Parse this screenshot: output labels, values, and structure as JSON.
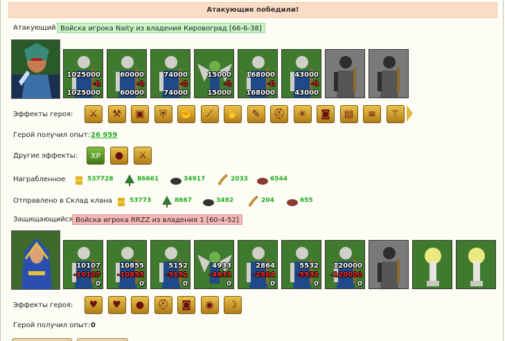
{
  "banner": {
    "text": "Атакующие победили!"
  },
  "attacker": {
    "label": "Атакующий",
    "army_name": "Войска игрока Naity из владения Кировоград [66-6-38]",
    "units": [
      {
        "name": "unit-1",
        "icon": "knight-icon",
        "count": "1025000",
        "loss": "-0",
        "remaining": "1025000"
      },
      {
        "name": "unit-2",
        "icon": "armored-warrior-icon",
        "count": "60000",
        "loss": "-0",
        "remaining": "60000"
      },
      {
        "name": "unit-3",
        "icon": "paladin-icon",
        "count": "74000",
        "loss": "-0",
        "remaining": "74000"
      },
      {
        "name": "unit-4",
        "icon": "winged-goblin-icon",
        "count": "15000",
        "loss": "-0",
        "remaining": "15000"
      },
      {
        "name": "unit-5",
        "icon": "archer-icon",
        "count": "168000",
        "loss": "-0",
        "remaining": "168000"
      },
      {
        "name": "unit-6",
        "icon": "elf-warrior-icon",
        "count": "43000",
        "loss": "-0",
        "remaining": "43000"
      },
      {
        "name": "unit-7",
        "icon": "hooded-monk-icon",
        "count": "",
        "loss": "",
        "remaining": ""
      },
      {
        "name": "unit-8",
        "icon": "ghost-mage-icon",
        "count": "",
        "loss": "",
        "remaining": ""
      }
    ],
    "effects_label": "Эффекты героя:",
    "effects": [
      "sword-icon",
      "axe-icon",
      "chest-icon",
      "shield-icon",
      "arm-icon",
      "blade-icon",
      "handshake-icon",
      "scroll-icon",
      "helmet-icon",
      "web-icon",
      "armor-icon",
      "book-icon",
      "parchment-icon",
      "staff-icon"
    ],
    "exp_label": "Герой получил опыт:",
    "exp_value": "26 959",
    "other_effects_label": "Другие эффекты:",
    "other_effects": [
      "xp-icon",
      "coins-icon",
      "sword-hand-icon"
    ],
    "loot_label": "Награбленное",
    "loot": [
      {
        "icon": "gold-icon",
        "value": "537728"
      },
      {
        "icon": "wood-icon",
        "value": "86661"
      },
      {
        "icon": "ore-icon",
        "value": "34917"
      },
      {
        "icon": "grain-icon",
        "value": "2033"
      },
      {
        "icon": "stone-icon",
        "value": "6544"
      }
    ],
    "clan_label": "Отправлено в Склад клана",
    "clan": [
      {
        "icon": "gold-icon",
        "value": "53773"
      },
      {
        "icon": "wood-icon",
        "value": "8667"
      },
      {
        "icon": "ore-icon",
        "value": "3492"
      },
      {
        "icon": "grain-icon",
        "value": "204"
      },
      {
        "icon": "stone-icon",
        "value": "655"
      }
    ]
  },
  "defender": {
    "label": "Защищающийся",
    "army_name": "Войска игрока RRZZ из владения 1 [60-4-52]",
    "units": [
      {
        "name": "unit-1",
        "icon": "knight-icon",
        "count": "10107",
        "loss": "-10107",
        "remaining": "0"
      },
      {
        "name": "unit-2",
        "icon": "armored-warrior-icon",
        "count": "10855",
        "loss": "-10855",
        "remaining": "0"
      },
      {
        "name": "unit-3",
        "icon": "paladin-icon",
        "count": "5152",
        "loss": "-5152",
        "remaining": "0"
      },
      {
        "name": "unit-4",
        "icon": "winged-goblin-icon",
        "count": "4933",
        "loss": "-4933",
        "remaining": "0"
      },
      {
        "name": "unit-5",
        "icon": "archer-icon",
        "count": "2864",
        "loss": "-2864",
        "remaining": "0"
      },
      {
        "name": "unit-6",
        "icon": "elf-warrior-icon",
        "count": "5532",
        "loss": "-5532",
        "remaining": "0"
      },
      {
        "name": "unit-7",
        "icon": "hooded-druid-icon",
        "count": "120000",
        "loss": "-120000",
        "remaining": "0"
      },
      {
        "name": "unit-8",
        "icon": "ghost-mage-icon",
        "count": "",
        "loss": "",
        "remaining": ""
      },
      {
        "name": "unit-9",
        "icon": "light-tower-icon",
        "count": "",
        "loss": "",
        "remaining": ""
      },
      {
        "name": "unit-10",
        "icon": "light-tower-icon",
        "count": "",
        "loss": "",
        "remaining": ""
      }
    ],
    "effects_label": "Эффекты героя:",
    "effects": [
      "heart-icon",
      "heart-sword-icon",
      "apple-icon",
      "helmet-icon",
      "armor-icon",
      "coin-icon",
      "bow-icon"
    ],
    "exp_label": "Герой получил опыт:",
    "exp_value": "0"
  },
  "colors": {
    "banner": "#fbdcc6",
    "attacker_label": "#c9f5c5",
    "defender_label": "#f7b8b8",
    "positive": "#1faa1f",
    "loss": "#ff2a2a"
  }
}
